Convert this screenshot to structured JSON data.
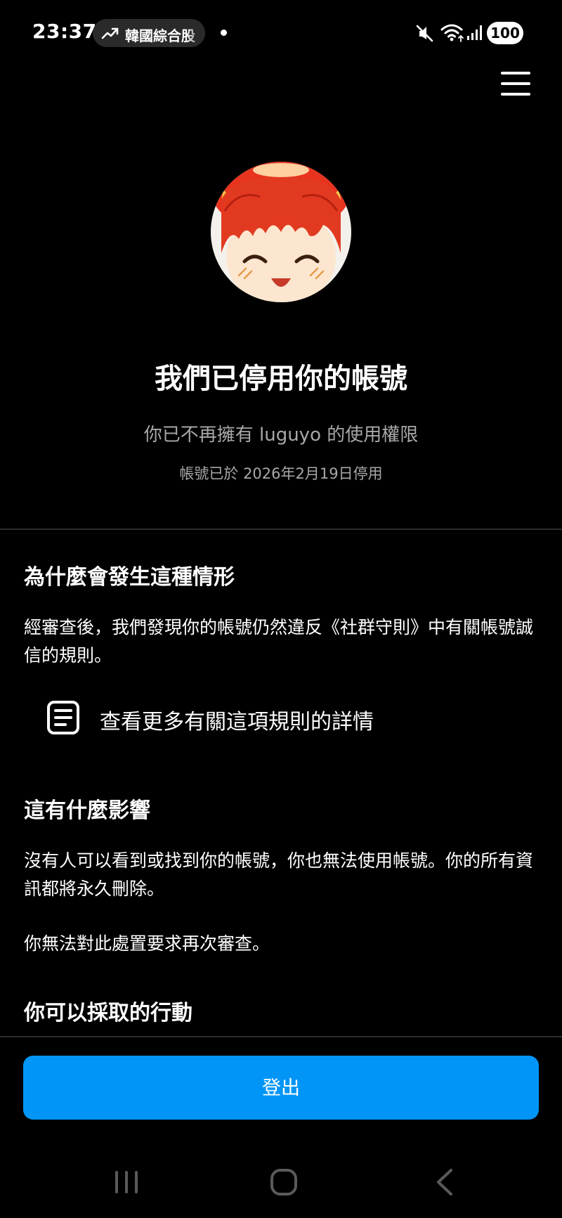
{
  "status_bar": {
    "time": "23:37",
    "trending_text": "韓國綜合股",
    "battery": "100",
    "icons": [
      "trending-arrow-icon",
      "notification-dot-icon",
      "mute-icon",
      "wifi-icon",
      "signal-icon",
      "battery-icon"
    ]
  },
  "header": {
    "menu_icon": "hamburger-menu-icon"
  },
  "profile": {
    "avatar_icon": "anime-avatar-icon"
  },
  "headline": {
    "title": "我們已停用你的帳號",
    "access_text": "你已不再擁有 luguyo 的使用權限",
    "date_text": "帳號已於 2026年2月19日停用"
  },
  "why_section": {
    "heading": "為什麼會發生這種情形",
    "body": "經審查後，我們發現你的帳號仍然違反《社群守則》中有關帳號誠信的規則。",
    "rule_link_label": "查看更多有關這項規則的詳情",
    "rule_link_icon": "document-icon"
  },
  "effect_section": {
    "heading": "這有什麼影響",
    "body": "沒有人可以看到或找到你的帳號，你也無法使用帳號。你的所有資訊都將永久刪除。",
    "appeal_text": "你無法對此處置要求再次審查。"
  },
  "actions_section": {
    "heading": "你可以採取的行動"
  },
  "footer": {
    "logout_label": "登出"
  },
  "system_nav": {
    "icons": [
      "recent-apps-icon",
      "home-icon",
      "back-icon"
    ]
  },
  "colors": {
    "background": "#000000",
    "primary_button": "#0095f6",
    "secondary_text": "#a8a8a8",
    "divider": "#2e2e2e"
  }
}
